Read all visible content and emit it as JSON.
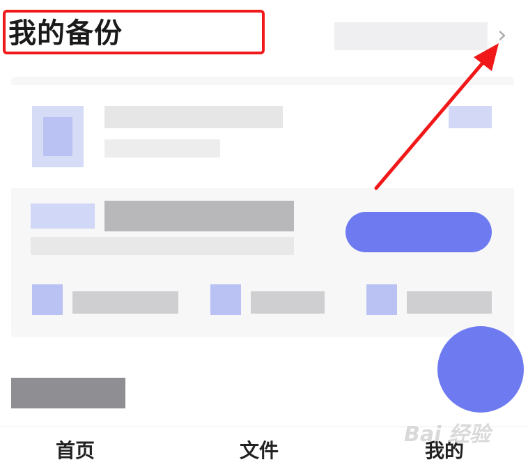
{
  "header": {
    "title": "我的备份"
  },
  "bottom_nav": {
    "tabs": [
      {
        "label": "首页"
      },
      {
        "label": "文件"
      },
      {
        "label": "我的"
      }
    ]
  },
  "watermark": {
    "text": "Bai 经验"
  },
  "colors": {
    "accent": "#6e7bf0",
    "annotation_red": "#f01818"
  },
  "icons": {
    "header_more": "chevron-right-icon",
    "fab": "fab-icon"
  }
}
